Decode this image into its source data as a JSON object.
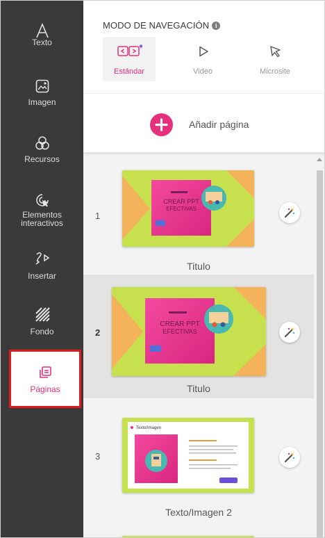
{
  "sidebar": {
    "items": [
      {
        "label": "Texto",
        "icon": "text-icon"
      },
      {
        "label": "Imagen",
        "icon": "image-icon"
      },
      {
        "label": "Recursos",
        "icon": "resources-icon"
      },
      {
        "label": "Elementos interactivos",
        "icon": "interactive-elements-icon"
      },
      {
        "label": "Insertar",
        "icon": "insert-icon"
      },
      {
        "label": "Fondo",
        "icon": "background-icon"
      },
      {
        "label": "Páginas",
        "icon": "pages-icon",
        "active": true
      }
    ]
  },
  "navigation": {
    "title": "MODO DE NAVEGACIÓN",
    "info_icon": "i",
    "modes": [
      {
        "label": "Estándar",
        "selected": true,
        "icon": "standard-mode-icon"
      },
      {
        "label": "Video",
        "selected": false,
        "icon": "play-icon"
      },
      {
        "label": "Microsite",
        "selected": false,
        "icon": "cursor-icon"
      }
    ]
  },
  "add_page": {
    "label": "Añadir página",
    "icon": "plus-icon"
  },
  "pages": [
    {
      "number": "1",
      "title": "Titulo",
      "slide_text": "CREAR PPT EFECTIVAS"
    },
    {
      "number": "2",
      "title": "Titulo",
      "slide_text": "CREAR PPT EFECTIVAS",
      "selected": true
    },
    {
      "number": "3",
      "title": "Texto/Imagen 2",
      "slide_text": "Texto/Imagen"
    }
  ],
  "colors": {
    "sidebar_bg": "#3a3a3a",
    "accent": "#e7307c",
    "highlight_border": "#e01b1b",
    "slide_green": "#c7e04e",
    "slide_pink": "#ee2f8e",
    "slide_orange": "#f4b35a"
  }
}
